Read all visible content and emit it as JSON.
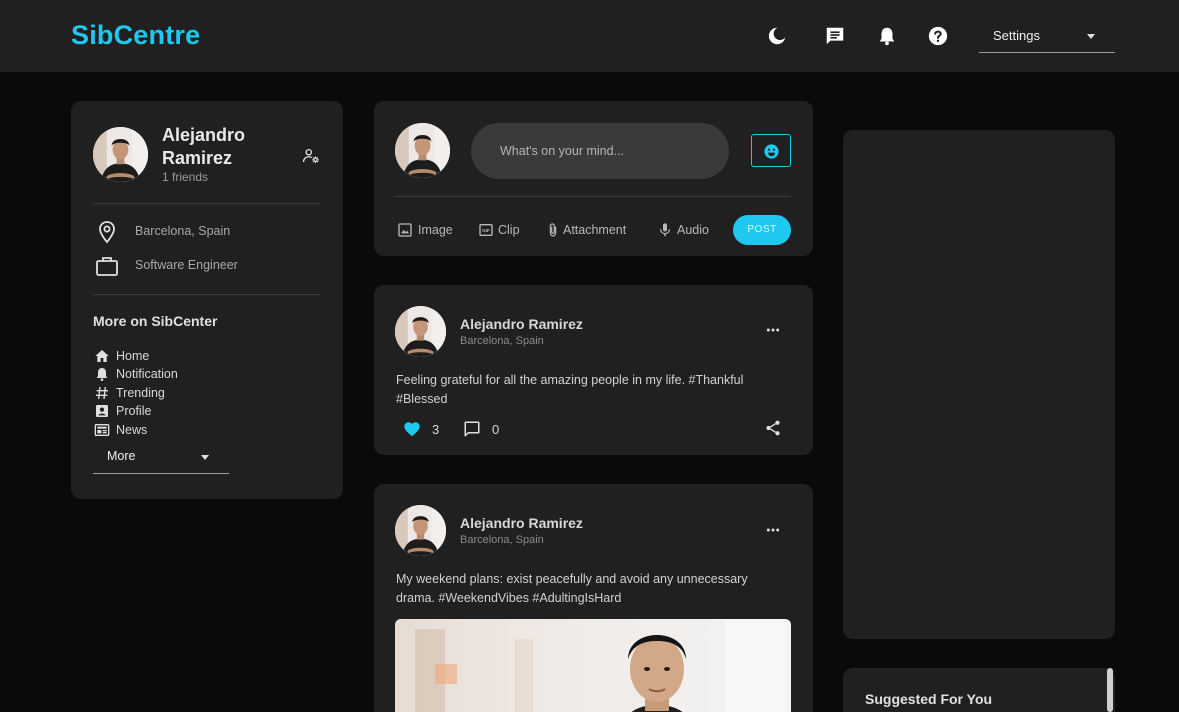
{
  "header": {
    "brand": "SibCentre",
    "settings_value": "Settings",
    "icons": [
      "moon-icon",
      "chat-icon",
      "bell-icon",
      "help-icon"
    ]
  },
  "profile": {
    "name": "Alejandro Ramirez",
    "friends": "1 friends",
    "location": "Barcelona, Spain",
    "occupation": "Software Engineer"
  },
  "more_section": {
    "title": "More on SibCenter",
    "items": [
      {
        "label": "Home",
        "icon": "home-icon"
      },
      {
        "label": "Notification",
        "icon": "bell-icon"
      },
      {
        "label": "Trending",
        "icon": "hashtag-icon"
      },
      {
        "label": "Profile",
        "icon": "profile-icon"
      },
      {
        "label": "News",
        "icon": "news-icon"
      }
    ],
    "more_value": "More"
  },
  "composer": {
    "placeholder": "What's on your mind...",
    "actions": [
      {
        "label": "Image",
        "icon": "image-icon"
      },
      {
        "label": "Clip",
        "icon": "gif-icon"
      },
      {
        "label": "Attachment",
        "icon": "paperclip-icon"
      },
      {
        "label": "Audio",
        "icon": "mic-icon"
      }
    ],
    "post_label": "POST"
  },
  "posts": [
    {
      "author": "Alejandro Ramirez",
      "location": "Barcelona, Spain",
      "text": "Feeling grateful for all the amazing people in my life. #Thankful #Blessed",
      "likes": "3",
      "comments": "0"
    },
    {
      "author": "Alejandro Ramirez",
      "location": "Barcelona, Spain",
      "text": "My weekend plans: exist peacefully and avoid any unnecessary drama. #WeekendVibes #AdultingIsHard"
    }
  ],
  "sidebar_right": {
    "suggested_title": "Suggested For You"
  },
  "colors": {
    "accent": "#1ec8ef",
    "background": "#0a0a0a",
    "card": "#202020",
    "topbar": "#202020"
  }
}
